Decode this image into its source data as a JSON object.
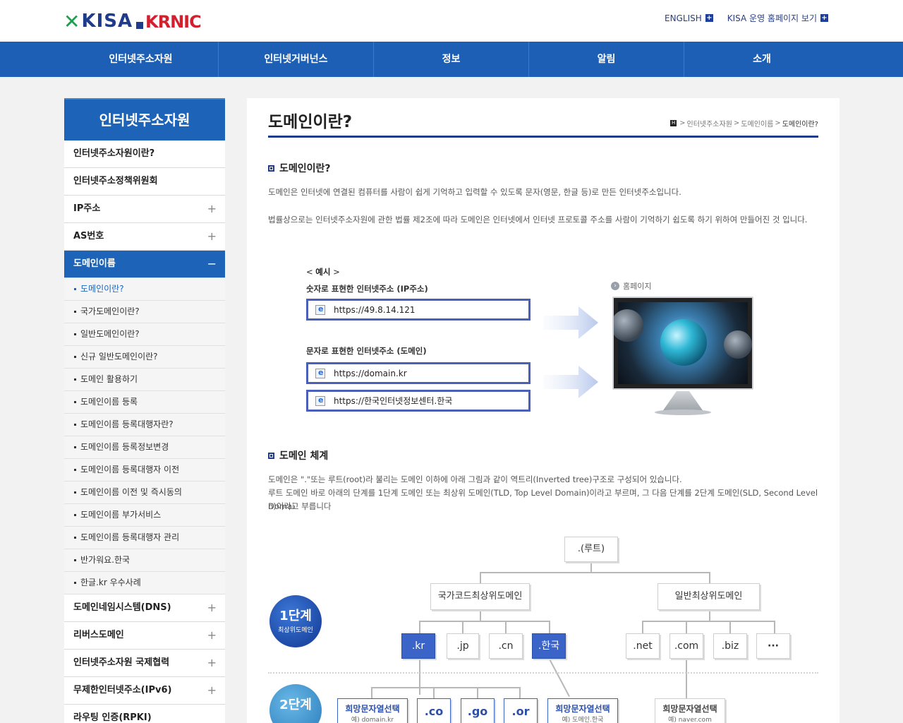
{
  "header": {
    "logo_kisa": "KISA",
    "logo_krnic": "KRNIC",
    "links": [
      "ENGLISH",
      "KISA 운영 홈페이지 보기"
    ]
  },
  "gnb": [
    "인터넷주소자원",
    "인터넷거버넌스",
    "정보",
    "알림",
    "소개"
  ],
  "sidebar": {
    "title": "인터넷주소자원",
    "items": [
      {
        "label": "인터넷주소자원이란?",
        "expand": ""
      },
      {
        "label": "인터넷주소정책위원회",
        "expand": ""
      },
      {
        "label": "IP주소",
        "expand": "+"
      },
      {
        "label": "AS번호",
        "expand": "+"
      },
      {
        "label": "도메인이름",
        "expand": "−"
      }
    ],
    "subitems": [
      "도메인이란?",
      "국가도메인이란?",
      "일반도메인이란?",
      "신규 일반도메인이란?",
      "도메인 활용하기",
      "도메인이름 등록",
      "도메인이름 등록대행자란?",
      "도메인이름 등록정보변경",
      "도메인이름 등록대행자 이전",
      "도메인이름 이전 및 즉시동의",
      "도메인이름 부가서비스",
      "도메인이름 등록대행자 관리",
      "반가워요.한국",
      "한글.kr 우수사례"
    ],
    "items_after": [
      {
        "label": "도메인네임시스템(DNS)",
        "expand": "+"
      },
      {
        "label": "리버스도메인",
        "expand": "+"
      },
      {
        "label": "인터넷주소자원 국제협력",
        "expand": "+"
      },
      {
        "label": "무제한인터넷주소(IPv6)",
        "expand": "+"
      },
      {
        "label": "라우팅 인증(RPKI)",
        "expand": ""
      }
    ]
  },
  "content": {
    "title": "도메인이란?",
    "breadcrumb": [
      "인터넷주소자원",
      "도메인이름",
      "도메인이란?"
    ],
    "breadcrumb_home": "H",
    "sec1_title": "도메인이란?",
    "sec1_p1": "도메인은 인터넷에 연결된 컴퓨터를 사람이 쉽게 기억하고 입력할 수 있도록 문자(영문, 한글 등)로 만든 인터넷주소입니다.",
    "sec1_p2": "법률상으로는 인터넷주소자원에 관한 법률 제2조에 따라 도메인은 인터넷에서 인터넷 프로토콜 주소를 사람이 기억하기 쉽도록 하기 위하여 만들어진 것 입니다.",
    "example_label": "예시",
    "ip_label": "숫자로 표현한 인터넷주소 (IP주소)",
    "ip_url": "https://49.8.14.121",
    "domain_label": "문자로 표현한 인터넷주소 (도메인)",
    "domain_url1": "https://domain.kr",
    "domain_url2": "https://한국인터넷정보센터.한국",
    "homepage_label": "홈페이지",
    "sec2_title": "도메인 체계",
    "sec2_p1": "도메인은 \".\"또는 루트(root)라 불리는 도메인 이하에 아래 그림과 같이 역트리(Inverted tree)구조로 구성되어 있습니다.",
    "sec2_p2": "루트 도메인 바로 아래의 단계를 1단계 도메인 또는 최상위 도메인(TLD, Top Level Domain)이라고 부르며, 그 다음 단계를 2단계 도메인(SLD, Second Level Domai",
    "sec2_p3": "n)이라고 부릅니다"
  },
  "tree": {
    "root": ".(루트)",
    "cc": "국가코드최상위도메인",
    "g": "일반최상위도메인",
    "cc_tlds": [
      ".kr",
      ".jp",
      ".cn",
      ".한국"
    ],
    "g_tlds": [
      ".net",
      ".com",
      ".biz",
      "···"
    ],
    "stage1": {
      "n": "1단계",
      "s": "최상위도메인"
    },
    "stage2": {
      "n": "2단계"
    },
    "sld": {
      "choice1_t": "희망문자열선택",
      "choice1_ex": "예) domain.kr",
      "co": ".co",
      "go": ".go",
      "or": ".or",
      "choice2_t": "희망문자열선택",
      "choice2_ex": "예) 도메인.한국",
      "choice3_t": "희망문자열선택",
      "choice3_ex": "예) naver.com"
    }
  }
}
